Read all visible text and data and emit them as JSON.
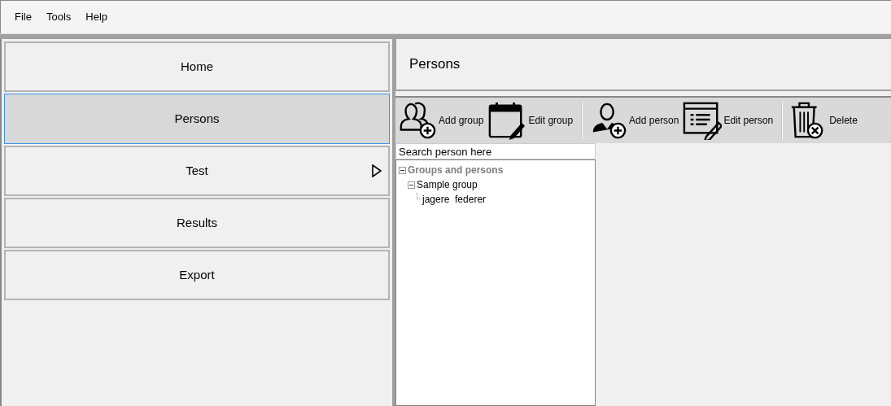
{
  "menu": [
    "File",
    "Tools",
    "Help"
  ],
  "nav": [
    {
      "label": "Home",
      "selected": false,
      "submenu": false
    },
    {
      "label": "Persons",
      "selected": true,
      "submenu": false
    },
    {
      "label": "Test",
      "selected": false,
      "submenu": true
    },
    {
      "label": "Results",
      "selected": false,
      "submenu": false
    },
    {
      "label": "Export",
      "selected": false,
      "submenu": false
    }
  ],
  "header": {
    "title": "Persons"
  },
  "toolbar": {
    "groups": [
      [
        {
          "kind": "add-group",
          "label": "Add group"
        },
        {
          "kind": "edit-group",
          "label": "Edit group"
        }
      ],
      [
        {
          "kind": "add-person",
          "label": "Add person"
        },
        {
          "kind": "edit-person",
          "label": "Edit person"
        }
      ],
      [
        {
          "kind": "delete",
          "label": "Delete"
        }
      ]
    ]
  },
  "search": {
    "placeholder": "Search person here"
  },
  "tree": [
    {
      "label": "Groups and persons",
      "expanded": true,
      "disabled": true,
      "children": [
        {
          "label": "Sample group",
          "expanded": true,
          "disabled": false,
          "children": [
            {
              "label": "jagere  federer",
              "disabled": false
            }
          ]
        }
      ]
    }
  ]
}
